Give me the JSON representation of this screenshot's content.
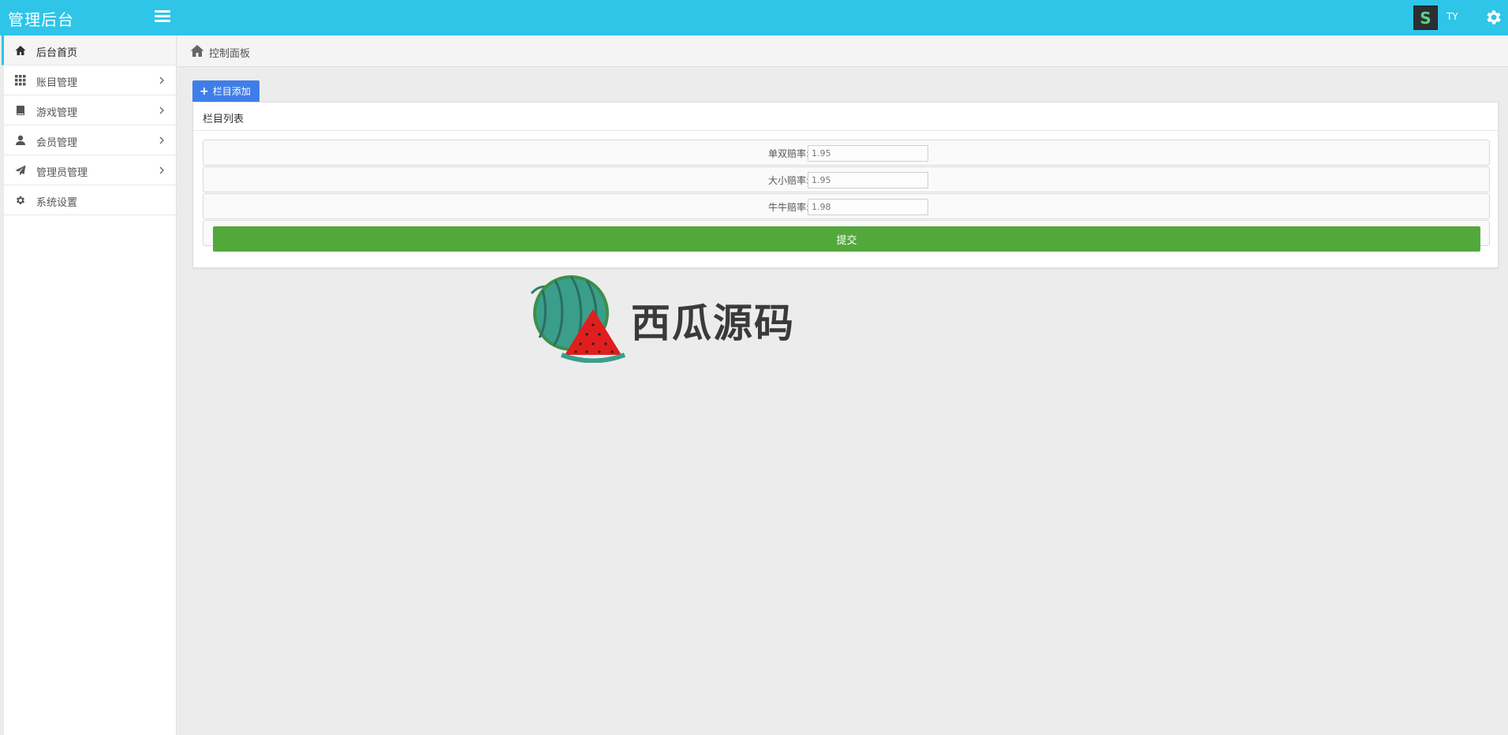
{
  "header": {
    "brand": "管理后台",
    "avatar_letter": "S",
    "username": "TY",
    "accent_color": "#2ec5e8"
  },
  "sidebar": {
    "items": [
      {
        "label": "后台首页",
        "icon": "home-icon",
        "active": true,
        "has_submenu": false
      },
      {
        "label": "账目管理",
        "icon": "grid-icon",
        "active": false,
        "has_submenu": true
      },
      {
        "label": "游戏管理",
        "icon": "book-icon",
        "active": false,
        "has_submenu": true
      },
      {
        "label": "会员管理",
        "icon": "user-icon",
        "active": false,
        "has_submenu": true
      },
      {
        "label": "管理员管理",
        "icon": "send-icon",
        "active": false,
        "has_submenu": true
      },
      {
        "label": "系统设置",
        "icon": "cog-icon",
        "active": false,
        "has_submenu": false
      }
    ]
  },
  "breadcrumb": {
    "label": "控制面板"
  },
  "main": {
    "add_button_label": "栏目添加",
    "panel_title": "栏目列表",
    "fields": [
      {
        "label": "单双赔率:",
        "value": "1.95"
      },
      {
        "label": "大小赔率:",
        "value": "1.95"
      },
      {
        "label": "牛牛赔率:",
        "value": "1.98"
      }
    ],
    "submit_label": "提交",
    "submit_color": "#53a83c",
    "add_button_color": "#3f7ee8"
  },
  "watermark": {
    "text": "西瓜源码"
  }
}
